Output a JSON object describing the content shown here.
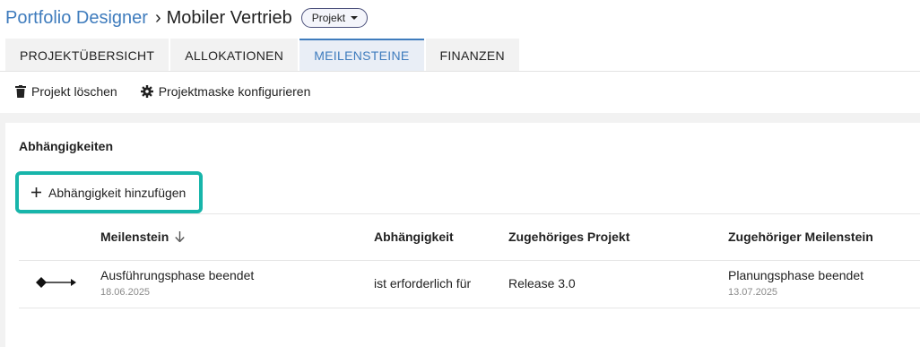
{
  "breadcrumb": {
    "root": "Portfolio Designer",
    "separator": "›",
    "current": "Mobiler Vertrieb",
    "type_label": "Projekt"
  },
  "tabs": [
    {
      "label": "PROJEKTÜBERSICHT",
      "active": false
    },
    {
      "label": "ALLOKATIONEN",
      "active": false
    },
    {
      "label": "MEILENSTEINE",
      "active": true
    },
    {
      "label": "FINANZEN",
      "active": false
    }
  ],
  "actions": {
    "delete_label": "Projekt löschen",
    "delete_icon": "trash-icon",
    "configure_label": "Projektmaske konfigurieren",
    "configure_icon": "gear-icon"
  },
  "section": {
    "title": "Abhängigkeiten",
    "add_label": "Abhängigkeit hinzufügen",
    "add_icon": "plus-icon"
  },
  "table": {
    "columns": {
      "milestone": "Meilenstein",
      "dependency": "Abhängigkeit",
      "project": "Zugehöriges Projekt",
      "related_milestone": "Zugehöriger Meilenstein"
    },
    "sort_icon": "arrow-down-icon",
    "rows": [
      {
        "icon": "dependency-arrow-icon",
        "milestone": "Ausführungsphase beendet",
        "milestone_date": "18.06.2025",
        "dependency": "ist erforderlich für",
        "project": "Release 3.0",
        "related_milestone": "Planungsphase beendet",
        "related_date": "13.07.2025"
      }
    ]
  },
  "colors": {
    "accent": "#3f7cbd",
    "highlight": "#17b5aa"
  }
}
